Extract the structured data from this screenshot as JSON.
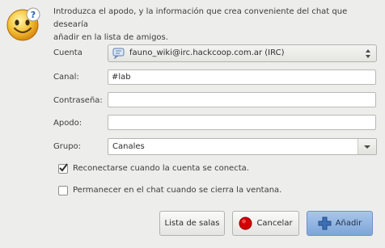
{
  "intro": {
    "line1": "Introduzca el apodo, y la información que crea conveniente del chat que desearía",
    "line2": "añadir en la lista de amigos."
  },
  "form": {
    "account_label": "Cuenta",
    "account_value": "fauno_wiki@irc.hackcoop.com.ar (IRC)",
    "channel_label": "Canal:",
    "channel_value": "#lab",
    "password_label": "Contraseña:",
    "password_value": "",
    "nick_label": "Apodo:",
    "nick_value": "",
    "group_label": "Grupo:",
    "group_value": "Canales"
  },
  "options": {
    "reconnect_label": "Reconectarse cuando la cuenta se conecta.",
    "reconnect_checked": true,
    "stay_label": "Permanecer en el chat cuando se cierra la ventana.",
    "stay_checked": false
  },
  "buttons": {
    "room_list": "Lista de salas",
    "cancel": "Cancelar",
    "add": "Añadir"
  },
  "colors": {
    "cancel_icon": "#d40000",
    "add_icon": "#3d6fb6"
  },
  "icons": {
    "dialog": "smiley-face-icon",
    "account": "irc-chat-icon"
  }
}
